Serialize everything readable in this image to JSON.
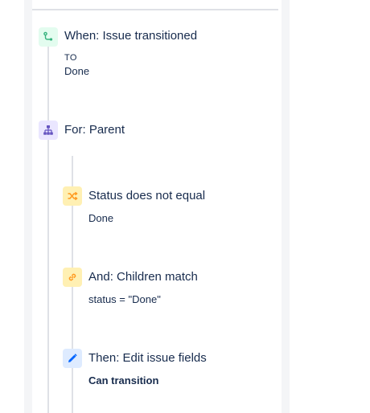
{
  "rule": {
    "trigger": {
      "title": "When: Issue transitioned",
      "to_label": "TO",
      "to_value": "Done",
      "icon": "issue-transitioned-icon",
      "color": "#36b37e"
    },
    "branch": {
      "title": "For: Parent",
      "icon": "branch-hierarchy-icon",
      "color": "#6554c0"
    },
    "condition": {
      "title": "Status does not equal",
      "value": "Done",
      "icon": "shuffle-condition-icon",
      "color": "#ff991f"
    },
    "and_condition": {
      "title": "And: Children match",
      "value": "status = \"Done\"",
      "icon": "link-icon",
      "color": "#ff991f"
    },
    "action": {
      "title": "Then: Edit issue fields",
      "value": "Can transition",
      "icon": "pencil-edit-icon",
      "color": "#0065ff"
    }
  }
}
